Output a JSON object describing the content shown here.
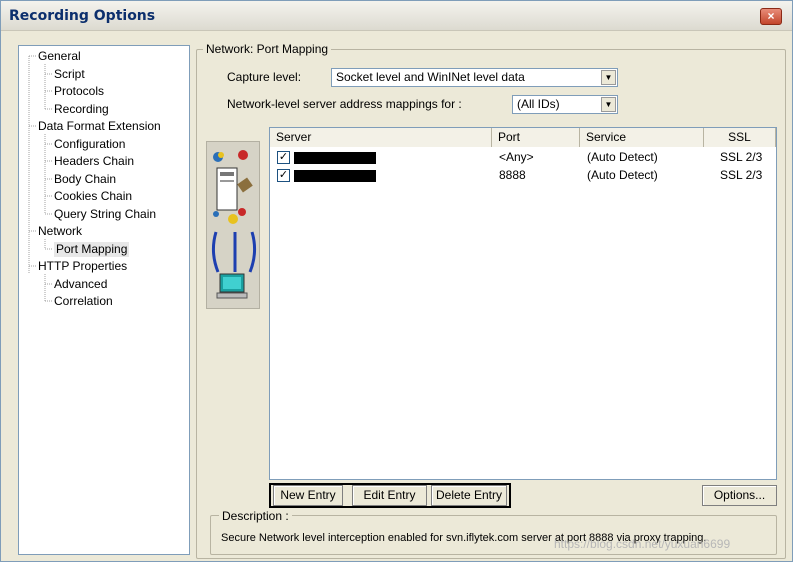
{
  "window": {
    "title": "Recording Options",
    "close_label": "×"
  },
  "tree": {
    "items": [
      {
        "label": "General"
      },
      {
        "label": "Script"
      },
      {
        "label": "Protocols"
      },
      {
        "label": "Recording"
      },
      {
        "label": "Data Format Extension"
      },
      {
        "label": "Configuration"
      },
      {
        "label": "Headers Chain"
      },
      {
        "label": "Body Chain"
      },
      {
        "label": "Cookies Chain"
      },
      {
        "label": "Query String Chain"
      },
      {
        "label": "Network"
      },
      {
        "label": "Port Mapping"
      },
      {
        "label": "HTTP Properties"
      },
      {
        "label": "Advanced"
      },
      {
        "label": "Correlation"
      }
    ]
  },
  "panel": {
    "group_title": "Network: Port Mapping",
    "capture_level_label": "Capture level:",
    "capture_level_value": "Socket level and WinINet level data",
    "mappings_label": "Network-level server address mappings for :",
    "mappings_value": "(All IDs)"
  },
  "table": {
    "columns": [
      "Server",
      "Port",
      "Service",
      "SSL"
    ],
    "rows": [
      {
        "checked": true,
        "server": "",
        "port": "<Any>",
        "service": "(Auto Detect)",
        "ssl": "SSL 2/3"
      },
      {
        "checked": true,
        "server": "",
        "port": "8888",
        "service": "(Auto Detect)",
        "ssl": "SSL 2/3"
      }
    ]
  },
  "buttons": {
    "new_entry": "New Entry",
    "edit_entry": "Edit Entry",
    "delete_entry": "Delete Entry",
    "options": "Options..."
  },
  "description": {
    "legend": "Description :",
    "text": "Secure  Network level interception enabled for svn.iflytek.com server at port 8888 via proxy trapping."
  },
  "watermark": "https://blog.csdn.net/yuxuan6699"
}
